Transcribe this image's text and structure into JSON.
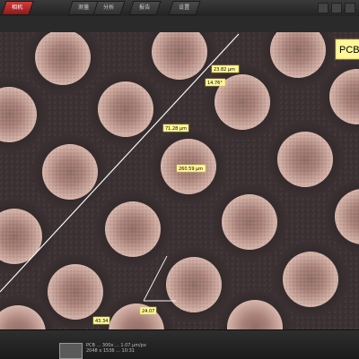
{
  "topbar": {
    "tabs": [
      {
        "label": "相机",
        "active": true
      },
      {
        "label": "测量",
        "active": false
      },
      {
        "label": "分析",
        "active": false
      },
      {
        "label": "报告",
        "active": false
      },
      {
        "label": "设置",
        "active": false
      }
    ]
  },
  "viewer": {
    "corner_label": "PCB",
    "measurements": [
      {
        "text": "23.82 μm"
      },
      {
        "text": "14.76°"
      },
      {
        "text": "71.28 μm"
      },
      {
        "text": "260.59 μm"
      },
      {
        "text": "24.07"
      },
      {
        "text": "43.34"
      }
    ]
  },
  "bottombar": {
    "status_line_1": "PCB ... 300x ... 1.07 μm/px",
    "status_line_2": "2048 x 1536 ... 10:31"
  },
  "colors": {
    "accent": "#c0282d",
    "label_bg": "#fff79a"
  }
}
